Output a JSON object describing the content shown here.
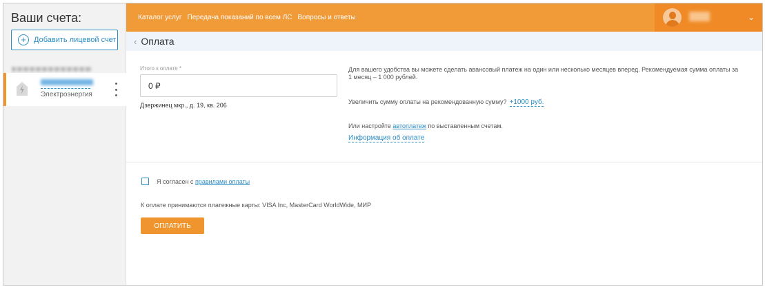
{
  "sidebar": {
    "title": "Ваши счета:",
    "add_account_label": "Добавить лицевой счет",
    "account": {
      "type": "Электроэнергия"
    }
  },
  "topbar": {
    "nav": [
      "Каталог услуг",
      "Передача показаний по всем ЛС",
      "Вопросы и ответы"
    ]
  },
  "breadcrumb": {
    "title": "Оплата"
  },
  "payment": {
    "amount_label": "Итого к оплате *",
    "amount_value": "0 ₽",
    "address": "Дзержинец мкр., д. 19, кв. 206",
    "advance_info": "Для вашего удобства вы можете сделать авансовый платеж на один или несколько месяцев вперед. Рекомендуемая сумма оплаты за 1 месяц – 1 000 рублей.",
    "increase_text": "Увеличить сумму оплаты на рекомендованную сумму?",
    "increase_link": "+1000 руб.",
    "autopay_prefix": "Или настройте ",
    "autopay_link": "автоплатеж",
    "autopay_suffix": " по выставленным счетам.",
    "info_link": "Информация об оплате",
    "agree_prefix": "Я согласен с ",
    "agree_link": "правилами оплаты",
    "cards_text": "К оплате принимаются платежные карты: VISA Inc, MasterCard WorldWide, МИР",
    "pay_button": "ОПЛАТИТЬ"
  },
  "colors": {
    "accent_orange": "#f19a38",
    "link_blue": "#2b8cc4"
  }
}
